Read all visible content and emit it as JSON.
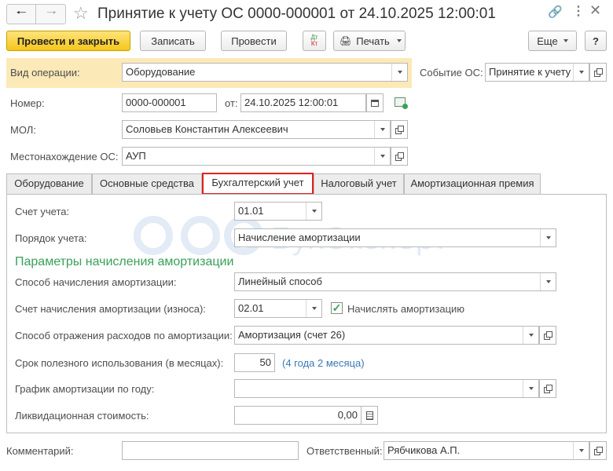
{
  "window": {
    "title": "Принятие к учету ОС 0000-000001 от 24.10.2025 12:00:01"
  },
  "toolbar": {
    "post_close_label": "Провести и закрыть",
    "save_label": "Записать",
    "post_label": "Провести",
    "dtkt_top": "Дт",
    "dtkt_bottom": "Кт",
    "print_label": "Печать",
    "more_label": "Еще"
  },
  "header": {
    "operation_type_label": "Вид операции:",
    "operation_type_value": "Оборудование",
    "event_label": "Событие ОС:",
    "event_value": "Принятие к учету",
    "number_label": "Номер:",
    "number_value": "0000-000001",
    "date_label": "от:",
    "date_value": "24.10.2025 12:00:01",
    "mol_label": "МОЛ:",
    "mol_value": "Соловьев Константин Алексеевич",
    "location_label": "Местонахождение ОС:",
    "location_value": "АУП"
  },
  "tabs": [
    {
      "label": "Оборудование",
      "active": false
    },
    {
      "label": "Основные средства",
      "active": false
    },
    {
      "label": "Бухгалтерский учет",
      "active": true
    },
    {
      "label": "Налоговый учет",
      "active": false
    },
    {
      "label": "Амортизационная премия",
      "active": false
    }
  ],
  "accounting": {
    "account_label": "Счет учета:",
    "account_value": "01.01",
    "order_label": "Порядок учета:",
    "order_value": "Начисление амортизации",
    "section_title": "Параметры начисления амортизации",
    "method_label": "Способ начисления амортизации:",
    "method_value": "Линейный способ",
    "depr_account_label": "Счет начисления амортизации (износа):",
    "depr_account_value": "02.01",
    "accrue_checkbox_label": "Начислять амортизацию",
    "accrue_checked": true,
    "expense_method_label": "Способ отражения расходов по амортизации:",
    "expense_method_value": "Амортизация (счет 26)",
    "useful_life_label": "Срок полезного использования (в месяцах):",
    "useful_life_value": "50",
    "useful_life_hint": "(4 года 2 месяца)",
    "schedule_label": "График амортизации по году:",
    "schedule_value": "",
    "liquidation_label": "Ликвидационная стоимость:",
    "liquidation_value": "0,00"
  },
  "watermark": {
    "text": "БухЭксперт"
  },
  "footer": {
    "comment_label": "Комментарий:",
    "comment_value": "",
    "responsible_label": "Ответственный:",
    "responsible_value": "Рябчикова А.П."
  },
  "colors": {
    "accent_yellow": "#f5c71a",
    "section_green": "#3aa05a",
    "hint_blue": "#3a78b8",
    "active_tab_border": "#e0201f",
    "highlight_bg": "#fbe9b7"
  }
}
